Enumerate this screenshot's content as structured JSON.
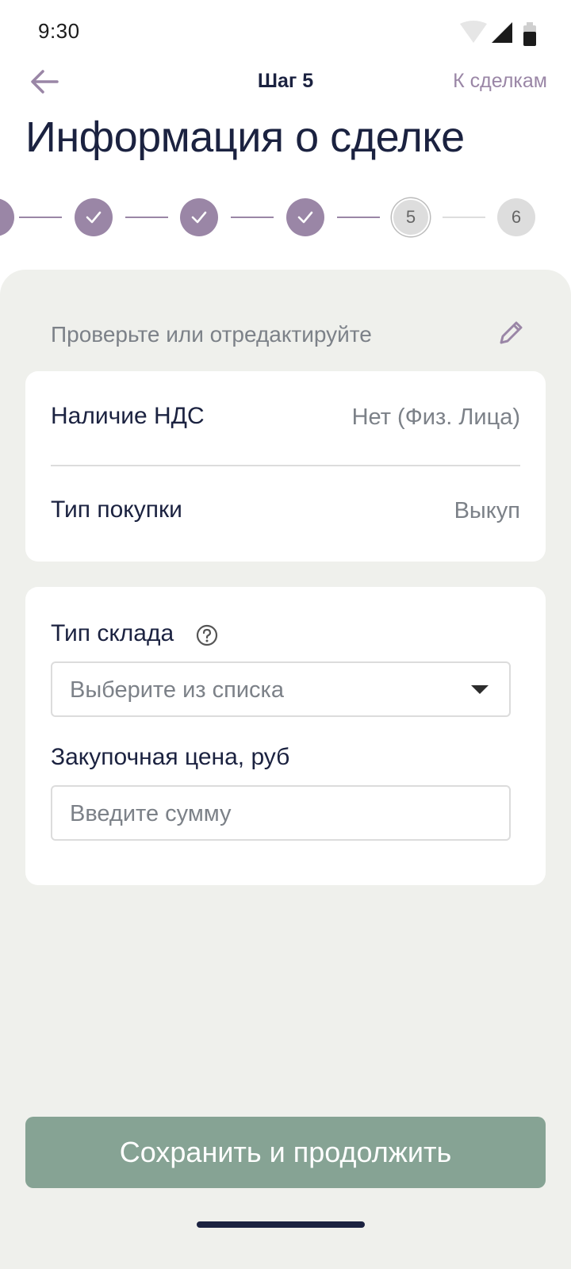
{
  "status_bar": {
    "time": "9:30",
    "icons": [
      "wifi-icon",
      "signal-icon",
      "battery-icon"
    ]
  },
  "nav": {
    "back_icon": "arrow-left-icon",
    "title": "Шаг 5",
    "link_label": "К сделкам"
  },
  "page": {
    "title": "Информация о сделке"
  },
  "stepper": {
    "total_steps": 6,
    "current_step": 5,
    "completed_steps": [
      1,
      2,
      3,
      4
    ],
    "labels": [
      "5",
      "6"
    ]
  },
  "review": {
    "label": "Проверьте или отредактируйте",
    "edit_icon": "pencil-icon"
  },
  "info": {
    "rows": [
      {
        "label": "Наличие НДС",
        "value": "Нет (Физ. Лица)"
      },
      {
        "label": "Тип покупки",
        "value": "Выкуп"
      }
    ]
  },
  "form": {
    "warehouse_type": {
      "label": "Тип склада",
      "help_icon": "question-circle-icon",
      "placeholder": "Выберите из списка"
    },
    "purchase_price": {
      "label": "Закупочная цена, руб",
      "placeholder": "Введите сумму"
    }
  },
  "actions": {
    "primary_label": "Сохранить и продолжить"
  },
  "colors": {
    "accent": "#9a86a6",
    "primary_button": "#86a394",
    "text_dark": "#1b2240",
    "text_muted": "#7c8188",
    "sheet_background": "#eff0ec"
  }
}
